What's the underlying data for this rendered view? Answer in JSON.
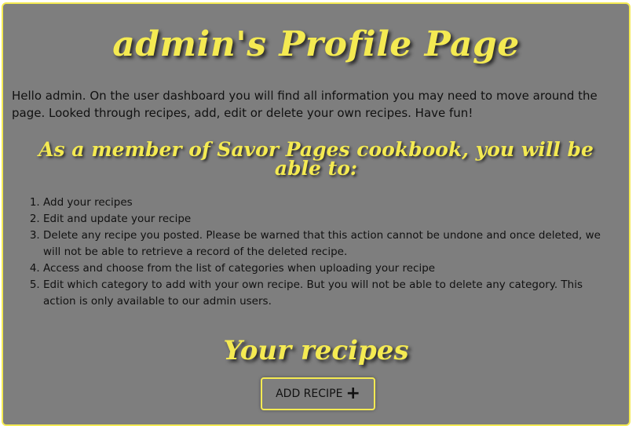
{
  "page": {
    "title": "admin's Profile Page",
    "intro": "Hello admin. On the user dashboard you will find all information you may need to move around the page. Looked through recipes, add, edit or delete your own recipes. Have fun!"
  },
  "member_section": {
    "heading": "As a member of Savor Pages cookbook, you will be able to:",
    "items": [
      "Add your recipes",
      "Edit and update your recipe",
      "Delete any recipe you posted. Please be warned that this action cannot be undone and once deleted, we will not be able to retrieve a record of the deleted recipe.",
      "Access and choose from the list of categories when uploading your recipe",
      "Edit which category to add with your own recipe. But you will not be able to delete any category. This action is only available to our admin users."
    ]
  },
  "recipes_section": {
    "heading": "Your recipes",
    "add_button_label": "ADD RECIPE",
    "add_button_icon": "plus-icon"
  },
  "colors": {
    "accent": "#f4ea52",
    "panel": "#7e7e7e",
    "text": "#111111"
  }
}
